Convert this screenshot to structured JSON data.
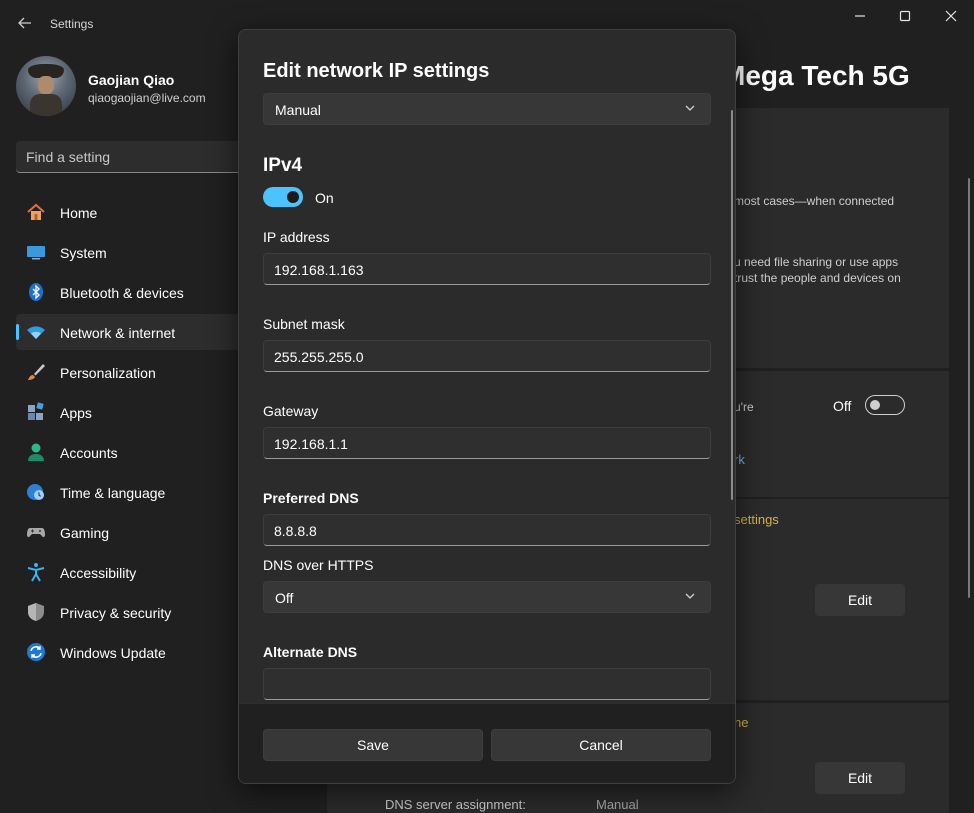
{
  "window": {
    "app_title": "Settings",
    "back_icon": "arrow-left-icon",
    "minimize_icon": "minimize-icon",
    "maximize_icon": "maximize-icon",
    "close_icon": "close-icon"
  },
  "profile": {
    "name": "Gaojian Qiao",
    "email": "qiaogaojian@live.com"
  },
  "search": {
    "placeholder": "Find a setting"
  },
  "sidebar": {
    "items": [
      {
        "label": "Home",
        "icon": "home-icon",
        "active": false
      },
      {
        "label": "System",
        "icon": "monitor-icon",
        "active": false
      },
      {
        "label": "Bluetooth & devices",
        "icon": "bluetooth-icon",
        "active": false
      },
      {
        "label": "Network & internet",
        "icon": "wifi-icon",
        "active": true
      },
      {
        "label": "Personalization",
        "icon": "paintbrush-icon",
        "active": false
      },
      {
        "label": "Apps",
        "icon": "apps-icon",
        "active": false
      },
      {
        "label": "Accounts",
        "icon": "person-icon",
        "active": false
      },
      {
        "label": "Time & language",
        "icon": "globe-clock-icon",
        "active": false
      },
      {
        "label": "Gaming",
        "icon": "gamepad-icon",
        "active": false
      },
      {
        "label": "Accessibility",
        "icon": "accessibility-icon",
        "active": false
      },
      {
        "label": "Privacy & security",
        "icon": "shield-icon",
        "active": false
      },
      {
        "label": "Windows Update",
        "icon": "update-icon",
        "active": false
      }
    ],
    "accent": "#4cc2ff"
  },
  "background": {
    "heading": "Mega Tech 5G",
    "text_1": "most cases—when connected",
    "text_2": "u need file sharing or use apps",
    "text_3": "trust the people and devices on",
    "text_4": "u're",
    "toggle_label": "Off",
    "link_1": "rk",
    "link_settings": "settings",
    "link_2": "ne",
    "edit_label_1": "Edit",
    "edit_label_2": "Edit",
    "dns_label": "DNS server assignment:",
    "dns_value": "Manual"
  },
  "dialog": {
    "title": "Edit network IP settings",
    "mode": "Manual",
    "section": "IPv4",
    "ipv4_toggle": "On",
    "ip_label": "IP address",
    "ip_value": "192.168.1.163",
    "subnet_label": "Subnet mask",
    "subnet_value": "255.255.255.0",
    "gateway_label": "Gateway",
    "gateway_value": "192.168.1.1",
    "preferred_dns_label": "Preferred DNS",
    "preferred_dns_value": "8.8.8.8",
    "doh_label": "DNS over HTTPS",
    "doh_value": "Off",
    "alternate_dns_label": "Alternate DNS",
    "save_label": "Save",
    "cancel_label": "Cancel"
  }
}
